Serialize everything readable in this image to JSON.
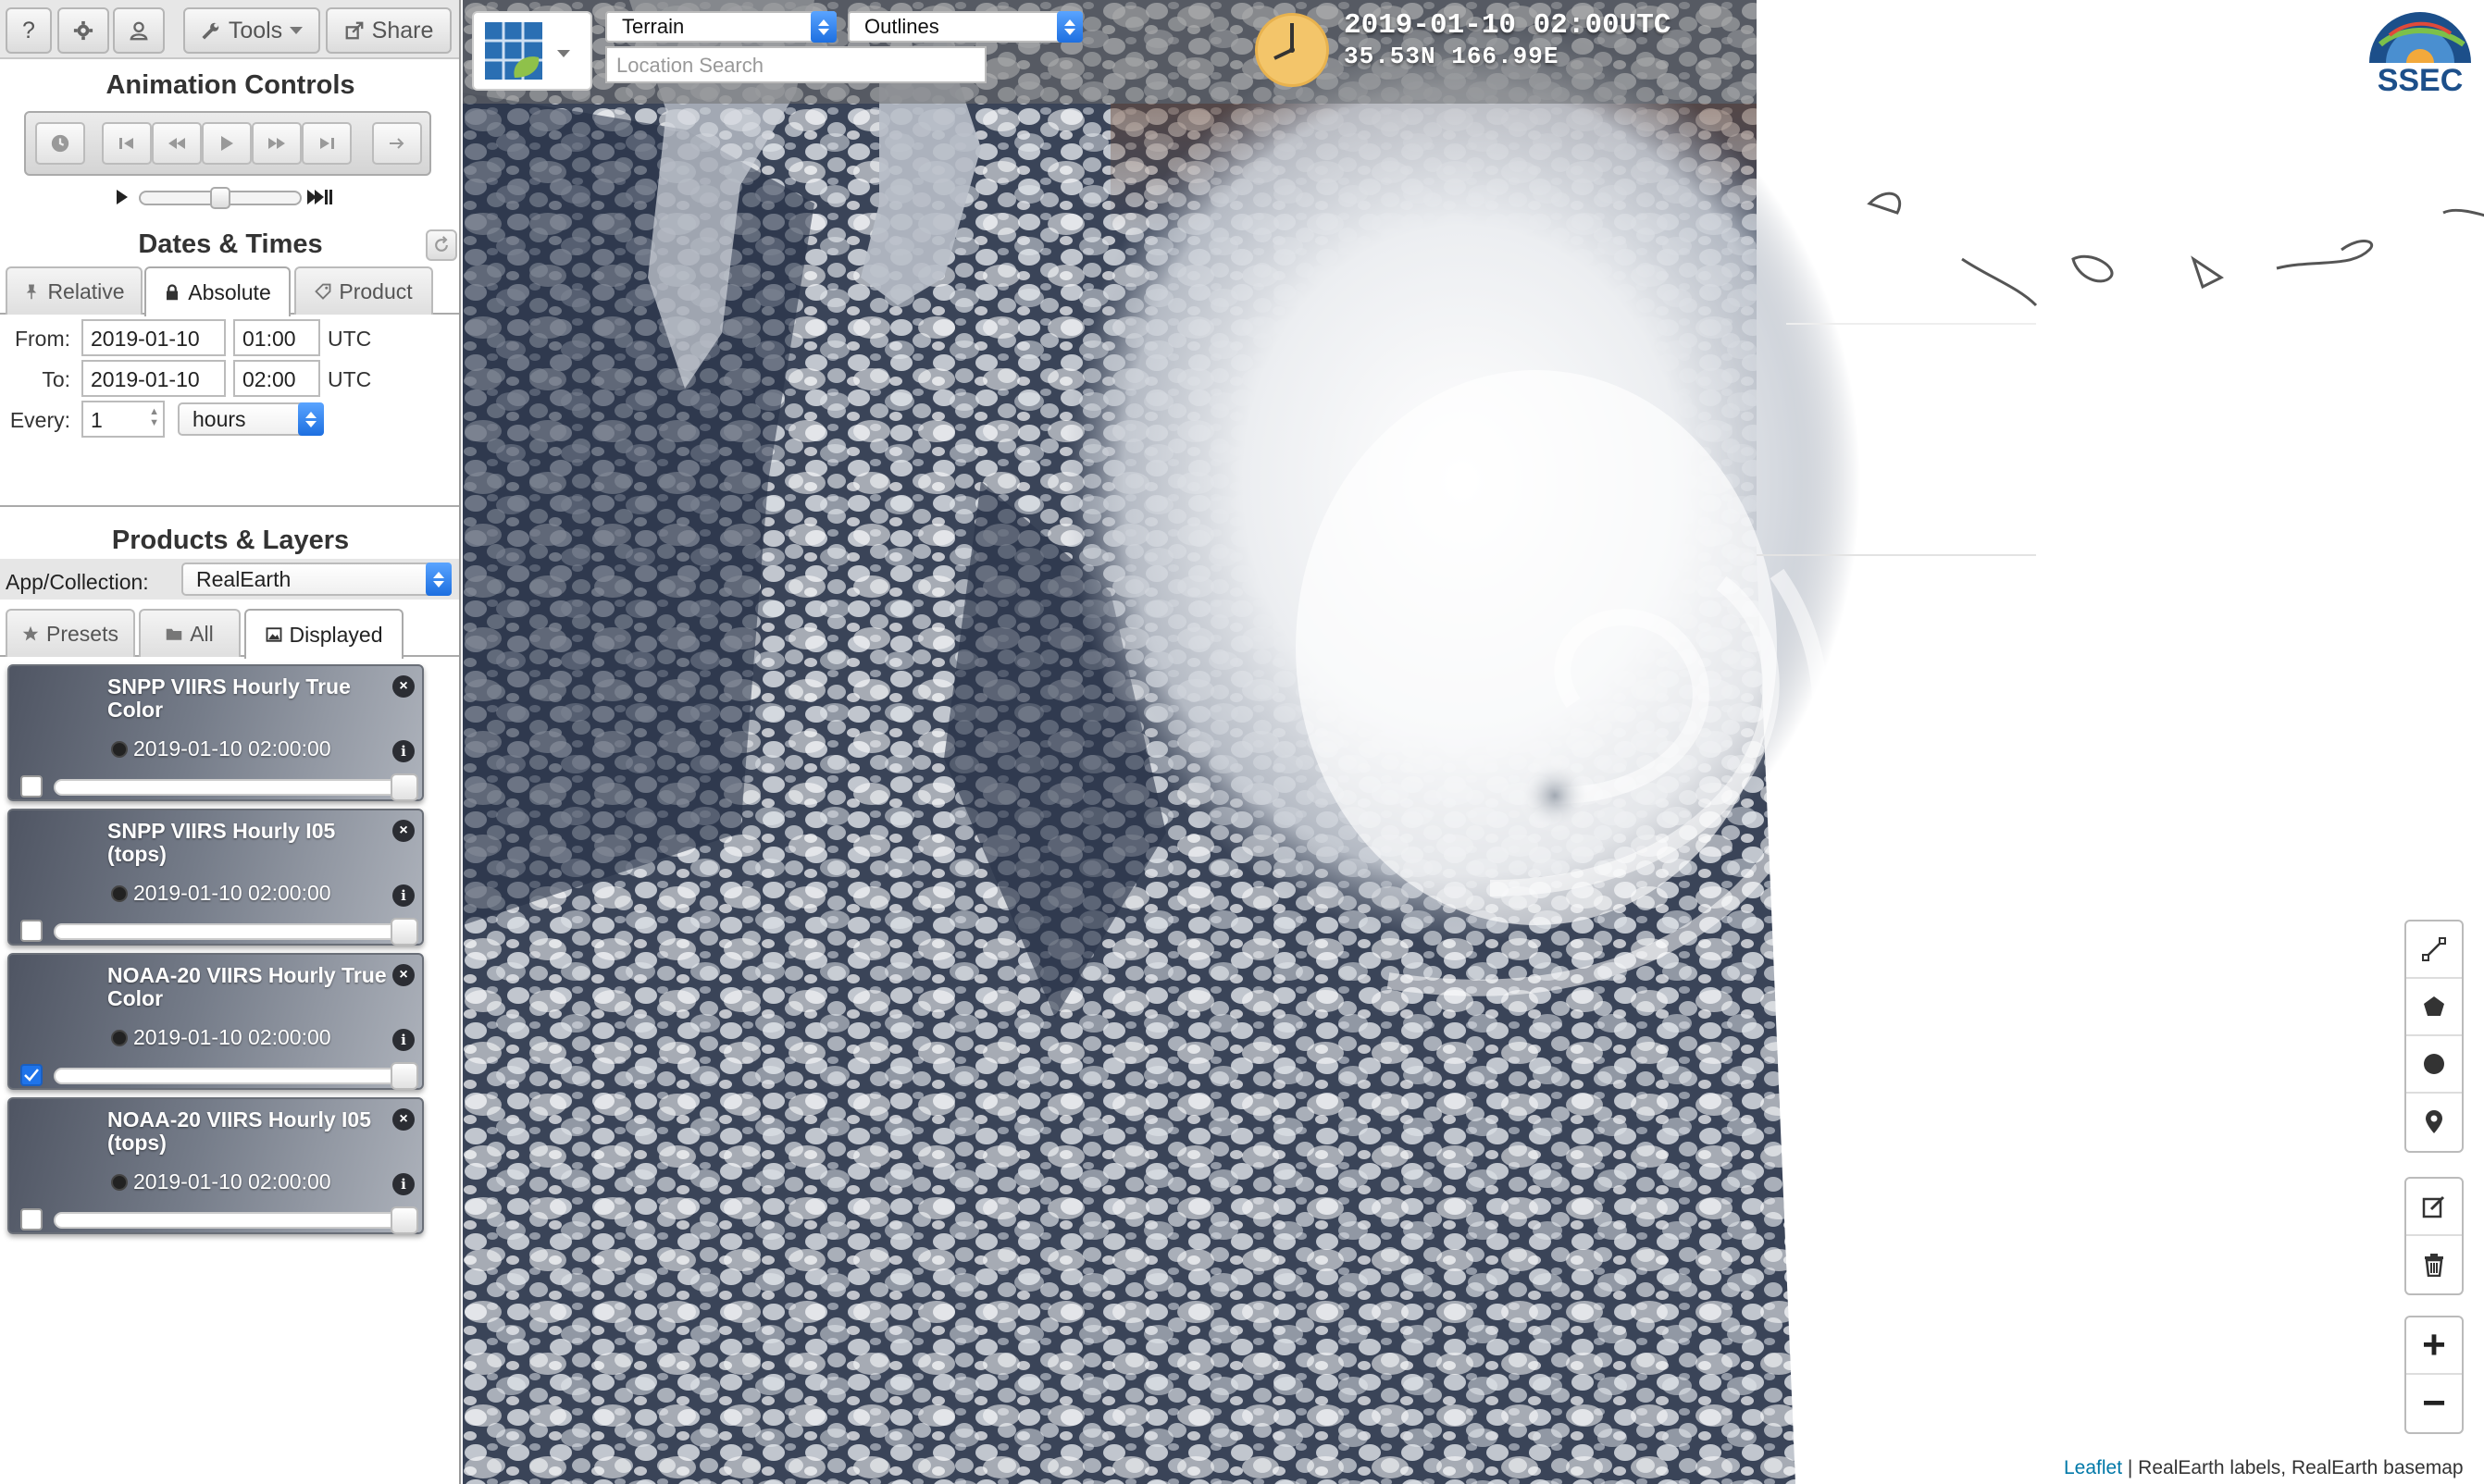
{
  "toolbar": {
    "help_label": "?",
    "tools_label": "Tools",
    "share_label": "Share"
  },
  "animation": {
    "title": "Animation Controls",
    "speed_fraction": 0.5
  },
  "dates": {
    "title": "Dates & Times",
    "tabs": [
      {
        "label": "Relative",
        "icon": "pin-icon"
      },
      {
        "label": "Absolute",
        "icon": "lock-icon",
        "active": true
      },
      {
        "label": "Product",
        "icon": "tag-icon"
      }
    ],
    "from_label": "From:",
    "to_label": "To:",
    "every_label": "Every:",
    "from_date": "2019-01-10",
    "from_time": "01:00",
    "to_date": "2019-01-10",
    "to_time": "02:00",
    "tz": "UTC",
    "every_value": "1",
    "every_unit": "hours"
  },
  "products": {
    "title": "Products & Layers",
    "collection_label": "App/Collection:",
    "collection_value": "RealEarth",
    "tabs": [
      {
        "label": "Presets",
        "icon": "star-icon"
      },
      {
        "label": "All",
        "icon": "folder-icon"
      },
      {
        "label": "Displayed",
        "icon": "image-icon",
        "active": true
      }
    ],
    "layers": [
      {
        "title": "SNPP VIIRS Hourly True Color",
        "time": "2019-01-10 02:00:00",
        "checked": false,
        "opacity": 1.0
      },
      {
        "title": "SNPP VIIRS Hourly I05 (tops)",
        "time": "2019-01-10 02:00:00",
        "checked": false,
        "opacity": 1.0
      },
      {
        "title": "NOAA-20 VIIRS Hourly True Color",
        "time": "2019-01-10 02:00:00",
        "checked": true,
        "opacity": 1.0
      },
      {
        "title": "NOAA-20 VIIRS Hourly I05 (tops)",
        "time": "2019-01-10 02:00:00",
        "checked": false,
        "opacity": 1.0
      }
    ]
  },
  "map": {
    "basemap": "Terrain",
    "overlay": "Outlines",
    "search_placeholder": "Location Search",
    "datetime": "2019-01-10 02:00UTC",
    "coords": "35.53N 166.99E",
    "logo_text": "SSEC",
    "attribution_link": "Leaflet",
    "attribution_text": " | RealEarth labels, RealEarth basemap"
  }
}
